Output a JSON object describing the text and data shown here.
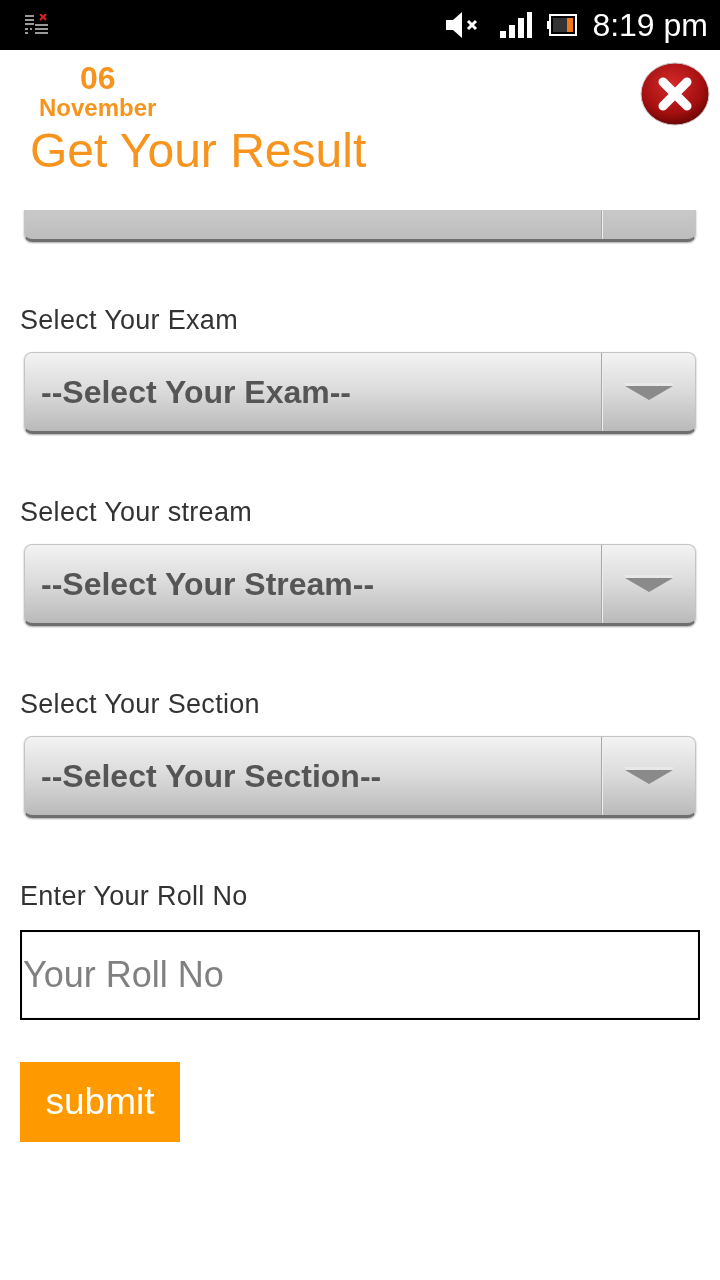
{
  "status_bar": {
    "time": "8:19 pm"
  },
  "header": {
    "day": "06",
    "month": "November",
    "title": "Get Your Result"
  },
  "fields": [
    {
      "kind": "select",
      "clipped": true
    },
    {
      "kind": "select",
      "clipped": false,
      "label": "Select Your Exam",
      "value": "--Select Your Exam--"
    },
    {
      "kind": "select",
      "clipped": false,
      "label": "Select Your stream",
      "value": "--Select Your Stream--"
    },
    {
      "kind": "select",
      "clipped": false,
      "label": "Select Your Section",
      "value": "--Select Your Section--"
    },
    {
      "kind": "text",
      "label": "Enter Your Roll No",
      "placeholder": "Your Roll No"
    }
  ],
  "submit": {
    "label": "submit"
  }
}
